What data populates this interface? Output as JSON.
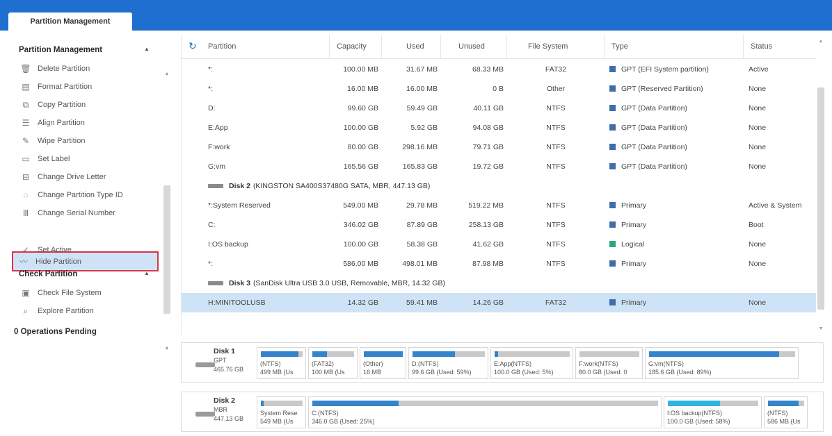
{
  "app": {
    "tab_label": "Partition Management"
  },
  "colors": {
    "topbar": "#1e6fcf",
    "accent": "#3383cd",
    "selected_row": "#cfe3f7",
    "highlight_border": "#d9344a",
    "logical": "#2aa87a"
  },
  "sidebar": {
    "sections": [
      {
        "title": "Partition Management",
        "items": [
          {
            "label": "Delete Partition",
            "icon": "trash-icon"
          },
          {
            "label": "Format Partition",
            "icon": "format-icon"
          },
          {
            "label": "Copy Partition",
            "icon": "copy-icon"
          },
          {
            "label": "Align Partition",
            "icon": "align-icon"
          },
          {
            "label": "Wipe Partition",
            "icon": "eraser-icon"
          },
          {
            "label": "Set Label",
            "icon": "label-icon"
          },
          {
            "label": "Change Drive Letter",
            "icon": "drive-letter-icon"
          },
          {
            "label": "Change Partition Type ID",
            "icon": "id-icon"
          },
          {
            "label": "Change Serial Number",
            "icon": "serial-icon"
          },
          {
            "label": "Hide Partition",
            "icon": "hide-icon"
          },
          {
            "label": "Set Active",
            "icon": "active-icon"
          }
        ]
      },
      {
        "title": "Check Partition",
        "items": [
          {
            "label": "Check File System",
            "icon": "check-fs-icon"
          },
          {
            "label": "Explore Partition",
            "icon": "search-icon"
          }
        ]
      }
    ],
    "pending": "0 Operations Pending"
  },
  "table": {
    "columns": [
      "Partition",
      "Capacity",
      "Used",
      "Unused",
      "File System",
      "Type",
      "Status"
    ],
    "disk1_rows": [
      {
        "partition": "*:",
        "capacity": "100.00 MB",
        "used": "31.67 MB",
        "unused": "68.33 MB",
        "fs": "FAT32",
        "type": "GPT (EFI System partition)",
        "status": "Active"
      },
      {
        "partition": "*:",
        "capacity": "16.00 MB",
        "used": "16.00 MB",
        "unused": "0 B",
        "fs": "Other",
        "type": "GPT (Reserved Partition)",
        "status": "None"
      },
      {
        "partition": "D:",
        "capacity": "99.60 GB",
        "used": "59.49 GB",
        "unused": "40.11 GB",
        "fs": "NTFS",
        "type": "GPT (Data Partition)",
        "status": "None"
      },
      {
        "partition": "E:App",
        "capacity": "100.00 GB",
        "used": "5.92 GB",
        "unused": "94.08 GB",
        "fs": "NTFS",
        "type": "GPT (Data Partition)",
        "status": "None"
      },
      {
        "partition": "F:work",
        "capacity": "80.00 GB",
        "used": "298.16 MB",
        "unused": "79.71 GB",
        "fs": "NTFS",
        "type": "GPT (Data Partition)",
        "status": "None"
      },
      {
        "partition": "G:vm",
        "capacity": "165.56 GB",
        "used": "165.83 GB",
        "unused": "19.72 GB",
        "fs": "NTFS",
        "type": "GPT (Data Partition)",
        "status": "None"
      }
    ],
    "disk2": {
      "name": "Disk 2",
      "desc": "(KINGSTON SA400S37480G SATA, MBR, 447.13 GB)"
    },
    "disk2_rows": [
      {
        "partition": "*:System Reserved",
        "capacity": "549.00 MB",
        "used": "29.78 MB",
        "unused": "519.22 MB",
        "fs": "NTFS",
        "type": "Primary",
        "status": "Active & System"
      },
      {
        "partition": "C:",
        "capacity": "346.02 GB",
        "used": "87.89 GB",
        "unused": "258.13 GB",
        "fs": "NTFS",
        "type": "Primary",
        "status": "Boot"
      },
      {
        "partition": "I:OS backup",
        "capacity": "100.00 GB",
        "used": "58.38 GB",
        "unused": "41.62 GB",
        "fs": "NTFS",
        "type": "Logical",
        "status": "None"
      },
      {
        "partition": "*:",
        "capacity": "586.00 MB",
        "used": "498.01 MB",
        "unused": "87.98 MB",
        "fs": "NTFS",
        "type": "Primary",
        "status": "None"
      }
    ],
    "disk3": {
      "name": "Disk 3",
      "desc": "(SanDisk Ultra USB 3.0 USB, Removable, MBR, 14.32 GB)"
    },
    "disk3_rows": [
      {
        "partition": "H:MINITOOLUSB",
        "capacity": "14.32 GB",
        "used": "59.41 MB",
        "unused": "14.26 GB",
        "fs": "FAT32",
        "type": "Primary",
        "status": "None"
      }
    ]
  },
  "diskmap": [
    {
      "name": "Disk 1",
      "scheme": "GPT",
      "size": "465.76 GB",
      "parts": [
        {
          "l1": "(NTFS)",
          "l2": "499 MB (Us",
          "used_fraction": 0.9,
          "color": "#3383cd"
        },
        {
          "l1": "(FAT32)",
          "l2": "100 MB (Us",
          "used_fraction": 0.35,
          "color": "#3383cd"
        },
        {
          "l1": "(Other)",
          "l2": "16 MB",
          "used_fraction": 1.0,
          "color": "#3383cd"
        },
        {
          "l1": "D:(NTFS)",
          "l2": "99.6 GB (Used: 59%)",
          "used_fraction": 0.59,
          "color": "#3383cd"
        },
        {
          "l1": "E:App(NTFS)",
          "l2": "100.0 GB (Used: 5%)",
          "used_fraction": 0.05,
          "color": "#3383cd"
        },
        {
          "l1": "F:work(NTFS)",
          "l2": "80.0 GB (Used: 0",
          "used_fraction": 0.0,
          "color": "#3383cd"
        },
        {
          "l1": "G:vm(NTFS)",
          "l2": "185.6 GB (Used: 89%)",
          "used_fraction": 0.89,
          "color": "#3383cd"
        }
      ]
    },
    {
      "name": "Disk 2",
      "scheme": "MBR",
      "size": "447.13 GB",
      "parts": [
        {
          "l1": "System Rese",
          "l2": "549 MB (Us",
          "used_fraction": 0.06,
          "color": "#3383cd"
        },
        {
          "l1": "C:(NTFS)",
          "l2": "346.0 GB (Used: 25%)",
          "used_fraction": 0.25,
          "color": "#3383cd"
        },
        {
          "l1": "I:OS backup(NTFS)",
          "l2": "100.0 GB (Used: 58%)",
          "used_fraction": 0.58,
          "color": "#2fb3e0"
        },
        {
          "l1": "(NTFS)",
          "l2": "586 MB (Us",
          "used_fraction": 0.85,
          "color": "#3383cd"
        }
      ]
    }
  ]
}
